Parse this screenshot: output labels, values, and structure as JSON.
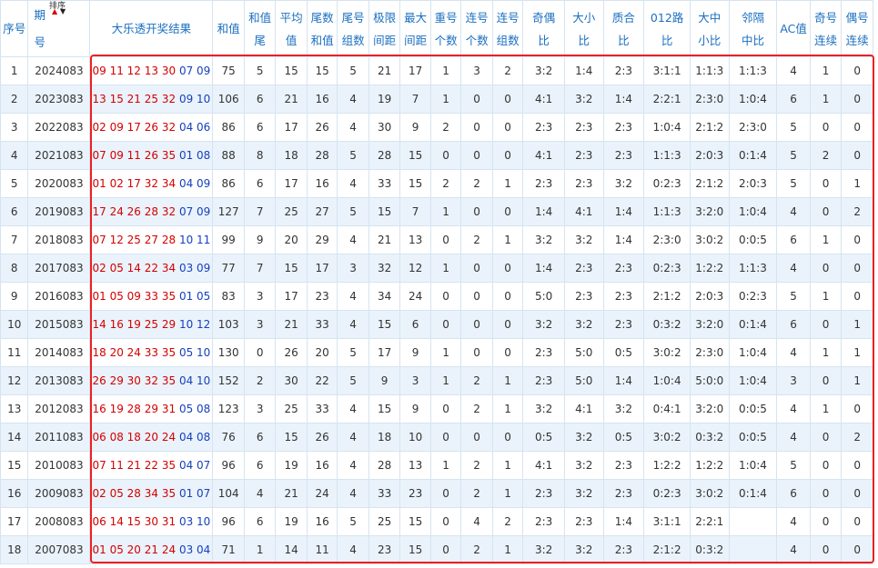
{
  "headers": {
    "idx": [
      "序号"
    ],
    "issue": [
      "期",
      "号"
    ],
    "sort_label": "排序",
    "result": "大乐透开奖结果",
    "sum": "和值",
    "sum_tail": [
      "和值",
      "尾"
    ],
    "avg": [
      "平均",
      "值"
    ],
    "tail_sum": [
      "尾数",
      "和值"
    ],
    "tail_groups": [
      "尾号",
      "组数"
    ],
    "extreme": [
      "极限",
      "间距"
    ],
    "max_gap": [
      "最大",
      "间距"
    ],
    "repeat": [
      "重号",
      "个数"
    ],
    "consec_count": [
      "连号",
      "个数"
    ],
    "consec_groups": [
      "连号",
      "组数"
    ],
    "odd_even": [
      "奇偶",
      "比"
    ],
    "big_small": [
      "大小",
      "比"
    ],
    "prime_comp": [
      "质合",
      "比"
    ],
    "route012": [
      "012路",
      "比"
    ],
    "big_mid_small": [
      "大中",
      "小比"
    ],
    "skip": [
      "邻隔",
      "中比"
    ],
    "ac": "AC值",
    "odd_consec": [
      "奇号",
      "连续"
    ],
    "even_consec": [
      "偶号",
      "连续"
    ]
  },
  "colors": {
    "front": "#d40000",
    "back": "#1540c0",
    "header_text": "#1a6fc0",
    "highlight": "#ec2020",
    "stripe": "#eaf3fb"
  },
  "rows": [
    {
      "idx": "1",
      "issue": "2024083",
      "front": "09 11 12 13 30",
      "back": "07 09",
      "sum": "75",
      "sum_tail": "5",
      "avg": "15",
      "tail_sum": "15",
      "tail_groups": "5",
      "extreme": "21",
      "max_gap": "17",
      "repeat": "1",
      "consec_count": "3",
      "consec_groups": "2",
      "odd_even": "3:2",
      "big_small": "1:4",
      "prime_comp": "2:3",
      "route012": "3:1:1",
      "big_mid_small": "1:1:3",
      "skip": "1:1:3",
      "ac": "4",
      "odd_consec": "1",
      "even_consec": "0"
    },
    {
      "idx": "2",
      "issue": "2023083",
      "front": "13 15 21 25 32",
      "back": "09 10",
      "sum": "106",
      "sum_tail": "6",
      "avg": "21",
      "tail_sum": "16",
      "tail_groups": "4",
      "extreme": "19",
      "max_gap": "7",
      "repeat": "1",
      "consec_count": "0",
      "consec_groups": "0",
      "odd_even": "4:1",
      "big_small": "3:2",
      "prime_comp": "1:4",
      "route012": "2:2:1",
      "big_mid_small": "2:3:0",
      "skip": "1:0:4",
      "ac": "6",
      "odd_consec": "1",
      "even_consec": "0"
    },
    {
      "idx": "3",
      "issue": "2022083",
      "front": "02 09 17 26 32",
      "back": "04 06",
      "sum": "86",
      "sum_tail": "6",
      "avg": "17",
      "tail_sum": "26",
      "tail_groups": "4",
      "extreme": "30",
      "max_gap": "9",
      "repeat": "2",
      "consec_count": "0",
      "consec_groups": "0",
      "odd_even": "2:3",
      "big_small": "2:3",
      "prime_comp": "2:3",
      "route012": "1:0:4",
      "big_mid_small": "2:1:2",
      "skip": "2:3:0",
      "ac": "5",
      "odd_consec": "0",
      "even_consec": "0"
    },
    {
      "idx": "4",
      "issue": "2021083",
      "front": "07 09 11 26 35",
      "back": "01 08",
      "sum": "88",
      "sum_tail": "8",
      "avg": "18",
      "tail_sum": "28",
      "tail_groups": "5",
      "extreme": "28",
      "max_gap": "15",
      "repeat": "0",
      "consec_count": "0",
      "consec_groups": "0",
      "odd_even": "4:1",
      "big_small": "2:3",
      "prime_comp": "2:3",
      "route012": "1:1:3",
      "big_mid_small": "2:0:3",
      "skip": "0:1:4",
      "ac": "5",
      "odd_consec": "2",
      "even_consec": "0"
    },
    {
      "idx": "5",
      "issue": "2020083",
      "front": "01 02 17 32 34",
      "back": "04 09",
      "sum": "86",
      "sum_tail": "6",
      "avg": "17",
      "tail_sum": "16",
      "tail_groups": "4",
      "extreme": "33",
      "max_gap": "15",
      "repeat": "2",
      "consec_count": "2",
      "consec_groups": "1",
      "odd_even": "2:3",
      "big_small": "2:3",
      "prime_comp": "3:2",
      "route012": "0:2:3",
      "big_mid_small": "2:1:2",
      "skip": "2:0:3",
      "ac": "5",
      "odd_consec": "0",
      "even_consec": "1"
    },
    {
      "idx": "6",
      "issue": "2019083",
      "front": "17 24 26 28 32",
      "back": "07 09",
      "sum": "127",
      "sum_tail": "7",
      "avg": "25",
      "tail_sum": "27",
      "tail_groups": "5",
      "extreme": "15",
      "max_gap": "7",
      "repeat": "1",
      "consec_count": "0",
      "consec_groups": "0",
      "odd_even": "1:4",
      "big_small": "4:1",
      "prime_comp": "1:4",
      "route012": "1:1:3",
      "big_mid_small": "3:2:0",
      "skip": "1:0:4",
      "ac": "4",
      "odd_consec": "0",
      "even_consec": "2"
    },
    {
      "idx": "7",
      "issue": "2018083",
      "front": "07 12 25 27 28",
      "back": "10 11",
      "sum": "99",
      "sum_tail": "9",
      "avg": "20",
      "tail_sum": "29",
      "tail_groups": "4",
      "extreme": "21",
      "max_gap": "13",
      "repeat": "0",
      "consec_count": "2",
      "consec_groups": "1",
      "odd_even": "3:2",
      "big_small": "3:2",
      "prime_comp": "1:4",
      "route012": "2:3:0",
      "big_mid_small": "3:0:2",
      "skip": "0:0:5",
      "ac": "6",
      "odd_consec": "1",
      "even_consec": "0"
    },
    {
      "idx": "8",
      "issue": "2017083",
      "front": "02 05 14 22 34",
      "back": "03 09",
      "sum": "77",
      "sum_tail": "7",
      "avg": "15",
      "tail_sum": "17",
      "tail_groups": "3",
      "extreme": "32",
      "max_gap": "12",
      "repeat": "1",
      "consec_count": "0",
      "consec_groups": "0",
      "odd_even": "1:4",
      "big_small": "2:3",
      "prime_comp": "2:3",
      "route012": "0:2:3",
      "big_mid_small": "1:2:2",
      "skip": "1:1:3",
      "ac": "4",
      "odd_consec": "0",
      "even_consec": "0"
    },
    {
      "idx": "9",
      "issue": "2016083",
      "front": "01 05 09 33 35",
      "back": "01 05",
      "sum": "83",
      "sum_tail": "3",
      "avg": "17",
      "tail_sum": "23",
      "tail_groups": "4",
      "extreme": "34",
      "max_gap": "24",
      "repeat": "0",
      "consec_count": "0",
      "consec_groups": "0",
      "odd_even": "5:0",
      "big_small": "2:3",
      "prime_comp": "2:3",
      "route012": "2:1:2",
      "big_mid_small": "2:0:3",
      "skip": "0:2:3",
      "ac": "5",
      "odd_consec": "1",
      "even_consec": "0"
    },
    {
      "idx": "10",
      "issue": "2015083",
      "front": "14 16 19 25 29",
      "back": "10 12",
      "sum": "103",
      "sum_tail": "3",
      "avg": "21",
      "tail_sum": "33",
      "tail_groups": "4",
      "extreme": "15",
      "max_gap": "6",
      "repeat": "0",
      "consec_count": "0",
      "consec_groups": "0",
      "odd_even": "3:2",
      "big_small": "3:2",
      "prime_comp": "2:3",
      "route012": "0:3:2",
      "big_mid_small": "3:2:0",
      "skip": "0:1:4",
      "ac": "6",
      "odd_consec": "0",
      "even_consec": "1"
    },
    {
      "idx": "11",
      "issue": "2014083",
      "front": "18 20 24 33 35",
      "back": "05 10",
      "sum": "130",
      "sum_tail": "0",
      "avg": "26",
      "tail_sum": "20",
      "tail_groups": "5",
      "extreme": "17",
      "max_gap": "9",
      "repeat": "1",
      "consec_count": "0",
      "consec_groups": "0",
      "odd_even": "2:3",
      "big_small": "5:0",
      "prime_comp": "0:5",
      "route012": "3:0:2",
      "big_mid_small": "2:3:0",
      "skip": "1:0:4",
      "ac": "4",
      "odd_consec": "1",
      "even_consec": "1"
    },
    {
      "idx": "12",
      "issue": "2013083",
      "front": "26 29 30 32 35",
      "back": "04 10",
      "sum": "152",
      "sum_tail": "2",
      "avg": "30",
      "tail_sum": "22",
      "tail_groups": "5",
      "extreme": "9",
      "max_gap": "3",
      "repeat": "1",
      "consec_count": "2",
      "consec_groups": "1",
      "odd_even": "2:3",
      "big_small": "5:0",
      "prime_comp": "1:4",
      "route012": "1:0:4",
      "big_mid_small": "5:0:0",
      "skip": "1:0:4",
      "ac": "3",
      "odd_consec": "0",
      "even_consec": "1"
    },
    {
      "idx": "13",
      "issue": "2012083",
      "front": "16 19 28 29 31",
      "back": "05 08",
      "sum": "123",
      "sum_tail": "3",
      "avg": "25",
      "tail_sum": "33",
      "tail_groups": "4",
      "extreme": "15",
      "max_gap": "9",
      "repeat": "0",
      "consec_count": "2",
      "consec_groups": "1",
      "odd_even": "3:2",
      "big_small": "4:1",
      "prime_comp": "3:2",
      "route012": "0:4:1",
      "big_mid_small": "3:2:0",
      "skip": "0:0:5",
      "ac": "4",
      "odd_consec": "1",
      "even_consec": "0"
    },
    {
      "idx": "14",
      "issue": "2011083",
      "front": "06 08 18 20 24",
      "back": "04 08",
      "sum": "76",
      "sum_tail": "6",
      "avg": "15",
      "tail_sum": "26",
      "tail_groups": "4",
      "extreme": "18",
      "max_gap": "10",
      "repeat": "0",
      "consec_count": "0",
      "consec_groups": "0",
      "odd_even": "0:5",
      "big_small": "3:2",
      "prime_comp": "0:5",
      "route012": "3:0:2",
      "big_mid_small": "0:3:2",
      "skip": "0:0:5",
      "ac": "4",
      "odd_consec": "0",
      "even_consec": "2"
    },
    {
      "idx": "15",
      "issue": "2010083",
      "front": "07 11 21 22 35",
      "back": "04 07",
      "sum": "96",
      "sum_tail": "6",
      "avg": "19",
      "tail_sum": "16",
      "tail_groups": "4",
      "extreme": "28",
      "max_gap": "13",
      "repeat": "1",
      "consec_count": "2",
      "consec_groups": "1",
      "odd_even": "4:1",
      "big_small": "3:2",
      "prime_comp": "2:3",
      "route012": "1:2:2",
      "big_mid_small": "1:2:2",
      "skip": "1:0:4",
      "ac": "5",
      "odd_consec": "0",
      "even_consec": "0"
    },
    {
      "idx": "16",
      "issue": "2009083",
      "front": "02 05 28 34 35",
      "back": "01 07",
      "sum": "104",
      "sum_tail": "4",
      "avg": "21",
      "tail_sum": "24",
      "tail_groups": "4",
      "extreme": "33",
      "max_gap": "23",
      "repeat": "0",
      "consec_count": "2",
      "consec_groups": "1",
      "odd_even": "2:3",
      "big_small": "3:2",
      "prime_comp": "2:3",
      "route012": "0:2:3",
      "big_mid_small": "3:0:2",
      "skip": "0:1:4",
      "ac": "6",
      "odd_consec": "0",
      "even_consec": "0"
    },
    {
      "idx": "17",
      "issue": "2008083",
      "front": "06 14 15 30 31",
      "back": "03 10",
      "sum": "96",
      "sum_tail": "6",
      "avg": "19",
      "tail_sum": "16",
      "tail_groups": "5",
      "extreme": "25",
      "max_gap": "15",
      "repeat": "0",
      "consec_count": "4",
      "consec_groups": "2",
      "odd_even": "2:3",
      "big_small": "2:3",
      "prime_comp": "1:4",
      "route012": "3:1:1",
      "big_mid_small": "2:2:1",
      "skip": "",
      "ac": "4",
      "odd_consec": "0",
      "even_consec": "0"
    },
    {
      "idx": "18",
      "issue": "2007083",
      "front": "01 05 20 21 24",
      "back": "03 04",
      "sum": "71",
      "sum_tail": "1",
      "avg": "14",
      "tail_sum": "11",
      "tail_groups": "4",
      "extreme": "23",
      "max_gap": "15",
      "repeat": "0",
      "consec_count": "2",
      "consec_groups": "1",
      "odd_even": "3:2",
      "big_small": "3:2",
      "prime_comp": "2:3",
      "route012": "2:1:2",
      "big_mid_small": "0:3:2",
      "skip": "",
      "ac": "4",
      "odd_consec": "0",
      "even_consec": "0"
    }
  ]
}
